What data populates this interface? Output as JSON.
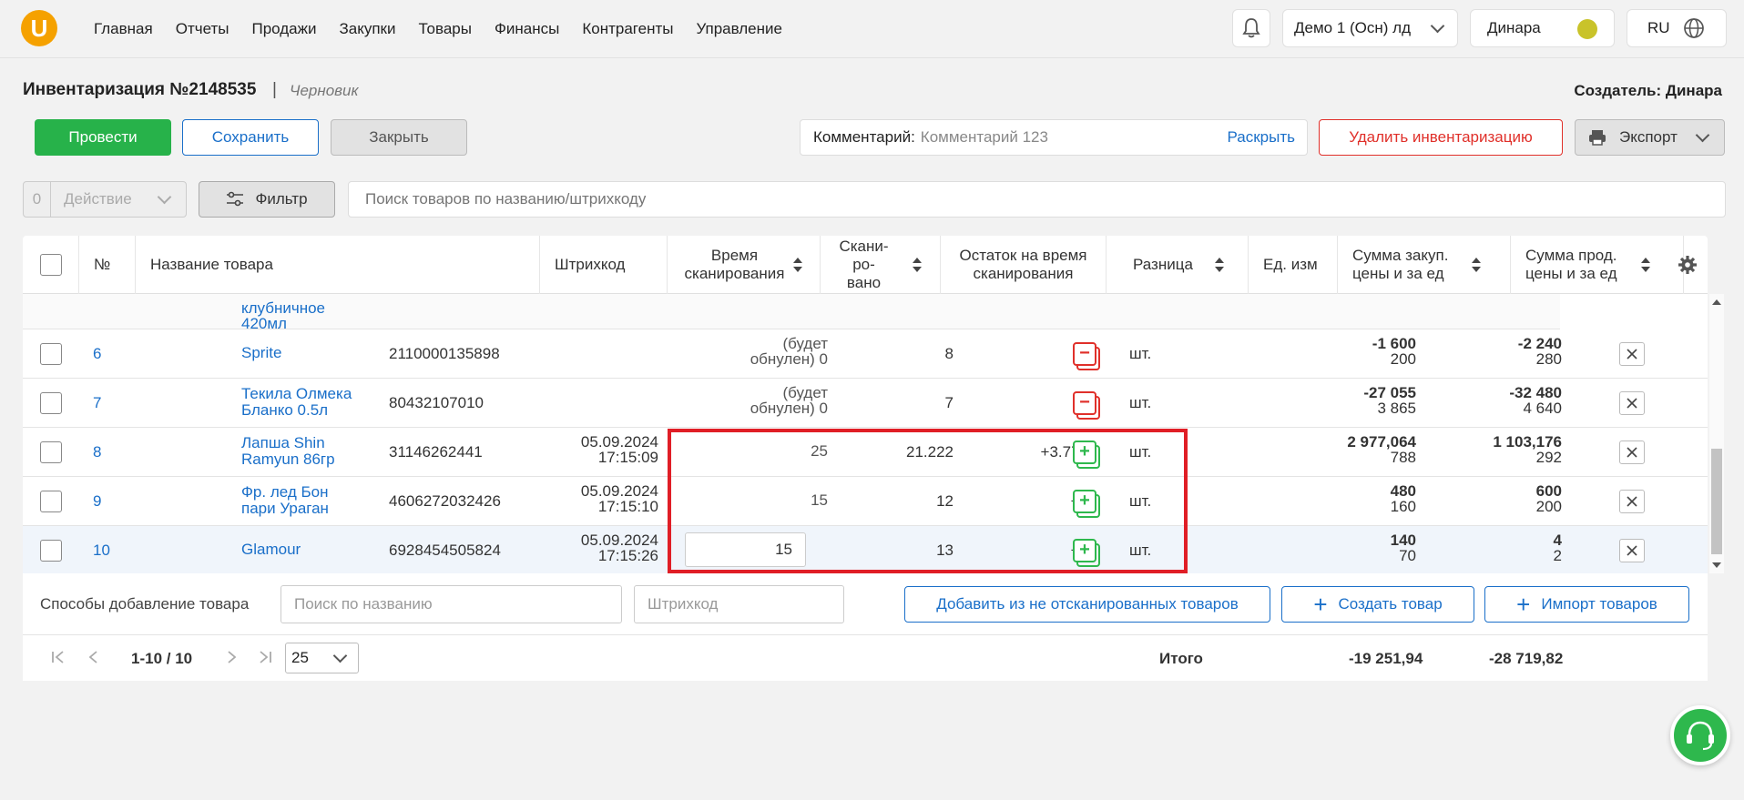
{
  "nav": {
    "logo": "U",
    "items": [
      "Главная",
      "Отчеты",
      "Продажи",
      "Закупки",
      "Товары",
      "Финансы",
      "Контрагенты",
      "Управление"
    ],
    "org": "Демо 1 (Осн) лд",
    "user": "Динара",
    "lang": "RU"
  },
  "doc": {
    "title": "Инвентаризация №2148535",
    "separator": "|",
    "status": "Черновик",
    "creator": "Создатель: Динара"
  },
  "toolbar": {
    "conduct": "Провести",
    "save": "Сохранить",
    "close": "Закрыть",
    "comment_label": "Комментарий:",
    "comment_value": "Комментарий 123",
    "expand": "Раскрыть",
    "delete": "Удалить инвентаризацию",
    "export": "Экспорт"
  },
  "filterbar": {
    "count": "0",
    "action": "Действие",
    "filter": "Фильтр",
    "search_placeholder": "Поиск товаров по названию/штрихкоду"
  },
  "table": {
    "headers": {
      "num": "№",
      "name": "Название товара",
      "barcode": "Штрихкод",
      "scan_time_1": "Время",
      "scan_time_2": "сканирования",
      "scanned_1": "Скани-",
      "scanned_2": "ро-",
      "scanned_3": "вано",
      "stock_1": "Остаток на время",
      "stock_2": "сканирования",
      "diff": "Разница",
      "unit": "Ед. изм",
      "purchase_1": "Сумма закуп.",
      "purchase_2": "цены и за ед",
      "sale_1": "Сумма прод.",
      "sale_2": "цены и за ед"
    },
    "partial_row": {
      "name_1": "клубничное",
      "name_2": "420мл"
    },
    "rows": [
      {
        "num": "6",
        "name_1": "Sprite",
        "name_2": "",
        "barcode": "2110000135898",
        "time_1": "",
        "time_2": "",
        "scanned_1": "(будет",
        "scanned_2": "обнулен) 0",
        "stock": "8",
        "diff": "-8",
        "diff_kind": "minus",
        "unit": "шт.",
        "purchase_total": "-1 600",
        "purchase_unit": "200",
        "sale_total": "-2 240",
        "sale_unit": "280"
      },
      {
        "num": "7",
        "name_1": "Текила Олмека",
        "name_2": "Бланко 0.5л",
        "barcode": "80432107010",
        "time_1": "",
        "time_2": "",
        "scanned_1": "(будет",
        "scanned_2": "обнулен) 0",
        "stock": "7",
        "diff": "-7",
        "diff_kind": "minus",
        "unit": "шт.",
        "purchase_total": "-27 055",
        "purchase_unit": "3 865",
        "sale_total": "-32 480",
        "sale_unit": "4 640"
      },
      {
        "num": "8",
        "name_1": "Лапша Shin",
        "name_2": "Ramyun 86гр",
        "barcode": "31146262441",
        "time_1": "05.09.2024",
        "time_2": "17:15:09",
        "scanned_1": "",
        "scanned_2": "25",
        "stock": "21.222",
        "diff": "+3.778",
        "diff_kind": "plus",
        "unit": "шт.",
        "purchase_total": "2 977,064",
        "purchase_unit": "788",
        "sale_total": "1 103,176",
        "sale_unit": "292"
      },
      {
        "num": "9",
        "name_1": "Фр. лед Бон",
        "name_2": "пари Ураган",
        "barcode": "4606272032426",
        "time_1": "05.09.2024",
        "time_2": "17:15:10",
        "scanned_1": "",
        "scanned_2": "15",
        "stock": "12",
        "diff": "+3",
        "diff_kind": "plus",
        "unit": "шт.",
        "purchase_total": "480",
        "purchase_unit": "160",
        "sale_total": "600",
        "sale_unit": "200"
      },
      {
        "num": "10",
        "name_1": "Glamour",
        "name_2": "",
        "barcode": "6928454505824",
        "time_1": "05.09.2024",
        "time_2": "17:15:26",
        "scanned_1": "",
        "scanned_2": "15",
        "stock": "13",
        "diff": "+2",
        "diff_kind": "plus",
        "unit": "шт.",
        "purchase_total": "140",
        "purchase_unit": "70",
        "sale_total": "4",
        "sale_unit": "2"
      }
    ],
    "selected_row_input": "15"
  },
  "addbar": {
    "label": "Способы добавление товара",
    "name_placeholder": "Поиск по названию",
    "barcode_placeholder": "Штрихкод",
    "add_unscanned": "Добавить из не отсканированных товаров",
    "create": "Создать товар",
    "import": "Импорт товаров"
  },
  "pager": {
    "range": "1-10 / 10",
    "page_size": "25",
    "total_label": "Итого",
    "total_purchase": "-19 251,94",
    "total_sale": "-28 719,82"
  },
  "colors": {
    "accent": "#1a6fc9",
    "green": "#27b24a",
    "red": "#e0302a",
    "highlight": "#e01e26"
  }
}
